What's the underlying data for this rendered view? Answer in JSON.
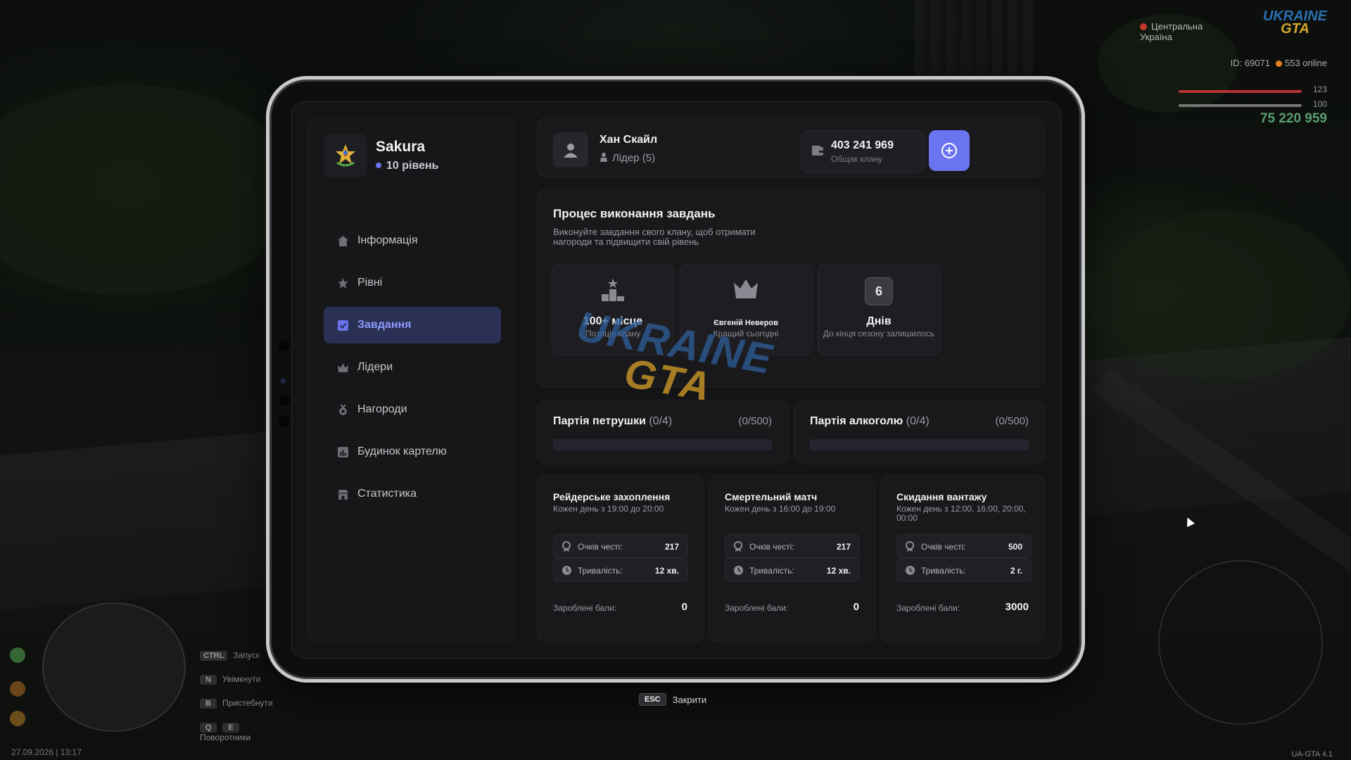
{
  "hud": {
    "region": "Центральна Україна",
    "logo_top": "UKRAINE",
    "logo_bottom": "GTA",
    "player_id": "ID: 69071",
    "online": "553 online",
    "health": "123",
    "armor": "100",
    "money": "75 220 959",
    "keys": [
      {
        "key": "CTRL",
        "label": "Запуск"
      },
      {
        "key": "N",
        "label": "Увімкнути"
      },
      {
        "key": "B",
        "label": "Пристебнути"
      },
      {
        "key": "Q",
        "key2": "E",
        "label": "Поворотники"
      }
    ],
    "datetime": "27.09.2026 | 13:17",
    "version": "UA-GTA 4.1"
  },
  "clan": {
    "name": "Sakura",
    "level": "10 рівень"
  },
  "menu": [
    {
      "label": "Інформація",
      "icon": "home-icon",
      "active": false
    },
    {
      "label": "Рівні",
      "icon": "star-icon",
      "active": false
    },
    {
      "label": "Завдання",
      "icon": "checkbox-icon",
      "active": true
    },
    {
      "label": "Лідери",
      "icon": "crown-icon",
      "active": false
    },
    {
      "label": "Нагороди",
      "icon": "medal-icon",
      "active": false
    },
    {
      "label": "Будинок картелю",
      "icon": "chart-icon",
      "active": false
    },
    {
      "label": "Статистика",
      "icon": "shop-icon",
      "active": false
    }
  ],
  "header": {
    "leader_name": "Хан Скайл",
    "leader_role": "Лідер (5)",
    "bank_value": "403 241 969",
    "bank_label": "Общак клану"
  },
  "process": {
    "title": "Процес виконання завдань",
    "description": "Виконуйте завдання свого клану, щоб отримати нагороди та підвищити свій рівень",
    "stats": [
      {
        "value": "100+ місце",
        "label": "Позиція клану",
        "icon": "podium-icon"
      },
      {
        "value": "Євгеній Неверов",
        "label": "Кращий сьогодні",
        "icon": "crown-icon"
      },
      {
        "value": "Днів",
        "badge": "6",
        "label": "До кінця сезону залишилось",
        "icon": "days-badge"
      }
    ],
    "watermark_top": "UKRAINE",
    "watermark_bottom": "GTA"
  },
  "parties": [
    {
      "title": "Партія петрушки",
      "count": "(0/4)",
      "max": "(0/500)",
      "progress": 0
    },
    {
      "title": "Партія алкоголю",
      "count": "(0/4)",
      "max": "(0/500)",
      "progress": 0
    }
  ],
  "tasks": [
    {
      "title": "Рейдерське захоплення",
      "time": "Кожен день з 19:00 до 20:00",
      "honor_label": "Очків честі:",
      "honor": "217",
      "duration_label": "Тривалість:",
      "duration": "12 хв.",
      "earned_label": "Зароблені бали:",
      "earned": "0"
    },
    {
      "title": "Смертельний матч",
      "time": "Кожен день з 16:00 до 19:00",
      "honor_label": "Очків честі:",
      "honor": "217",
      "duration_label": "Тривалість:",
      "duration": "12 хв.",
      "earned_label": "Зароблені бали:",
      "earned": "0"
    },
    {
      "title": "Скидання вантажу",
      "time": "Кожен день з 12:00, 16:00, 20:00, 00:00",
      "honor_label": "Очків честі:",
      "honor": "500",
      "duration_label": "Тривалість:",
      "duration": "2 г.",
      "earned_label": "Зароблені бали:",
      "earned": "3000"
    }
  ],
  "footer": {
    "esc_key": "ESC",
    "close_label": "Закрити"
  },
  "colors": {
    "accent": "#6b74f0",
    "active_bg": "#2b3154",
    "panel": "#19191c"
  }
}
